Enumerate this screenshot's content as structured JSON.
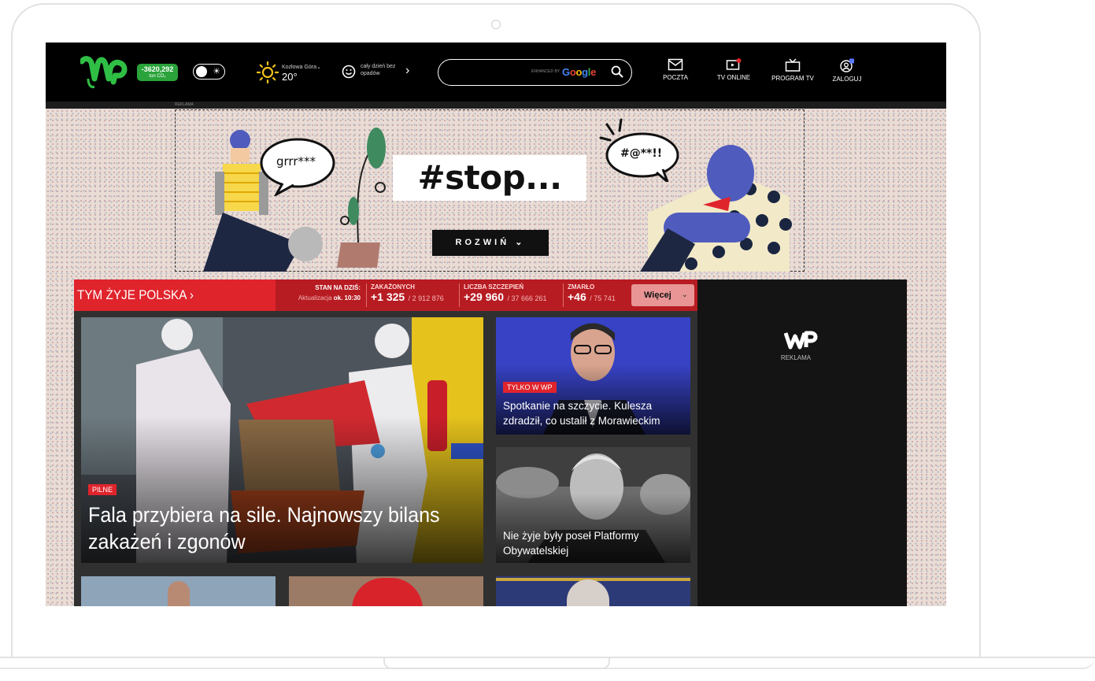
{
  "header": {
    "co2_value": "-3620,292",
    "co2_unit": "ton CO₂",
    "weather_city": "Kozłowa Góra",
    "weather_temp": "20°",
    "forecast": "cały dzień bez opadów",
    "search_enhanced": "ENHANCED BY",
    "search_google": "Google",
    "nav": [
      {
        "label": "POCZTA",
        "icon": "mail-icon"
      },
      {
        "label": "TV ONLINE",
        "icon": "tv-online-icon"
      },
      {
        "label": "PROGRAM TV",
        "icon": "tv-program-icon"
      },
      {
        "label": "ZALOGUJ",
        "icon": "user-icon"
      }
    ],
    "ad_tag": "REKLAMA"
  },
  "ad": {
    "title": "#stop...",
    "expand_label": "ROZWIŃ",
    "bubble_left": "grrr***",
    "bubble_right": "#@**!!"
  },
  "covid": {
    "title": "TYM ŻYJE POLSKA",
    "stand_label": "STAN NA DZIŚ:",
    "update_label": "Aktualizacja",
    "update_time": "ok. 10:30",
    "stats": [
      {
        "label": "ZAKAŻONYCH",
        "value": "+1 325",
        "total": "/ 2 912 876"
      },
      {
        "label": "LICZBA SZCZEPIEŃ",
        "value": "+29 960",
        "total": "/ 37 666 261"
      },
      {
        "label": "ZMARŁO",
        "value": "+46",
        "total": "/ 75 741"
      }
    ],
    "more_label": "Więcej"
  },
  "articles": {
    "main": {
      "badge": "PILNE",
      "headline": "Fala przybiera na sile. Najnowszy bilans zakażeń i zgonów"
    },
    "side1": {
      "badge": "TYLKO W WP",
      "headline": "Spotkanie na szczycie. Kulesza zdradził, co ustalił z Morawieckim"
    },
    "side2": {
      "headline": "Nie żyje były poseł Platformy Obywatelskiej"
    }
  },
  "right_ad": {
    "label": "REKLAMA"
  },
  "colors": {
    "brand_green": "#2aa33a",
    "covid_red": "#e0242c",
    "covid_dark_red": "#b71c22"
  }
}
